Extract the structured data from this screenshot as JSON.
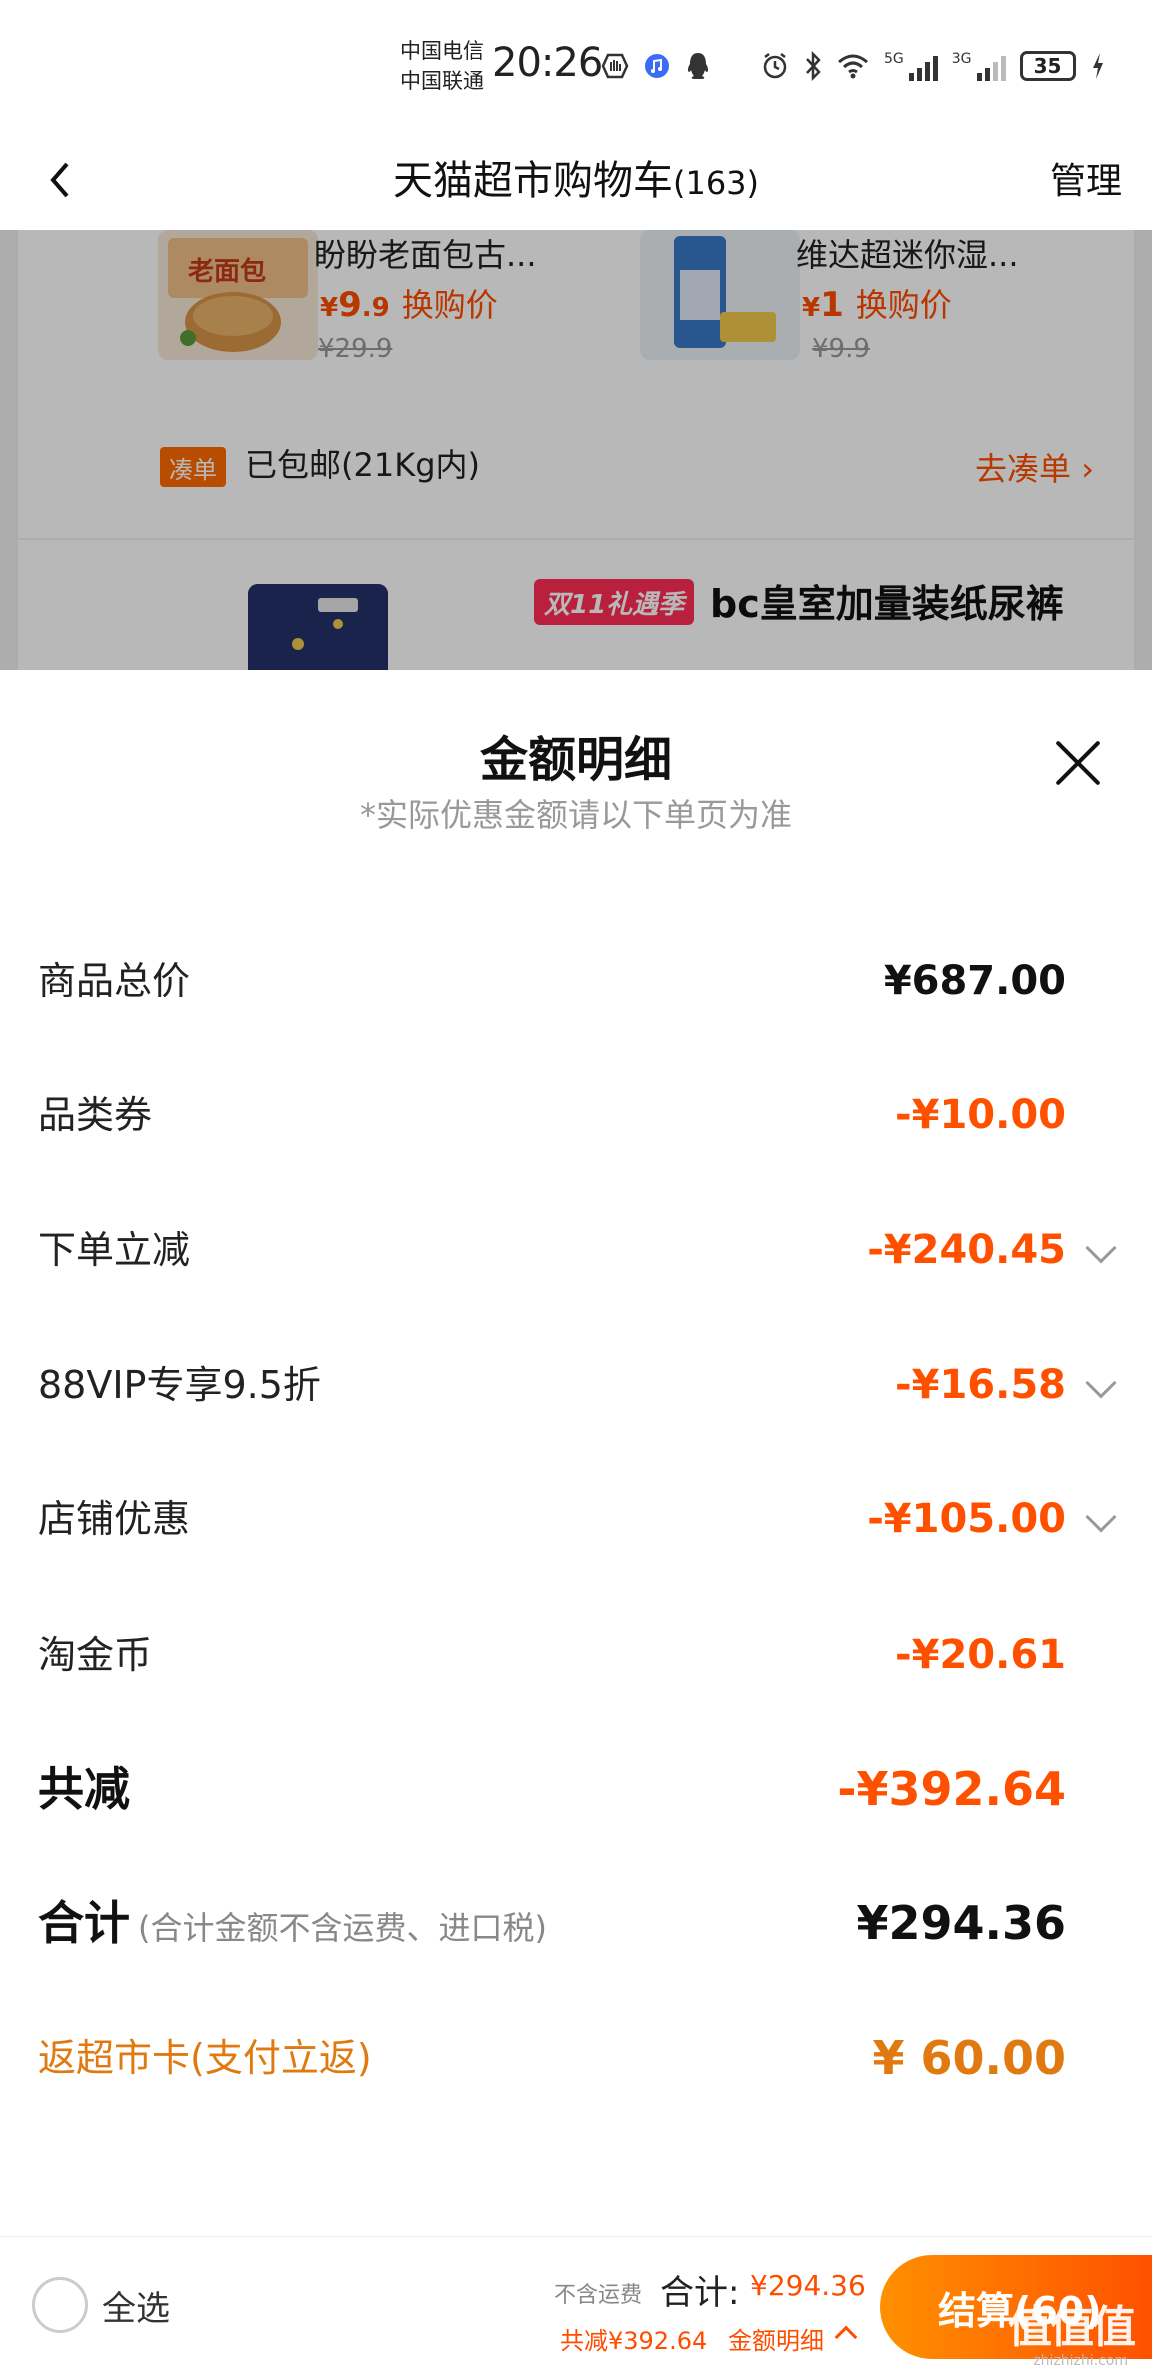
{
  "status_bar": {
    "carrier_1": "中国电信",
    "carrier_2": "中国联通",
    "time": "20:26",
    "signal_1_label": "5G",
    "signal_2_label": "3G",
    "battery": "35"
  },
  "nav": {
    "title": "天猫超市购物车",
    "count": "(163)",
    "manage_label": "管理"
  },
  "background": {
    "products": [
      {
        "name": "盼盼老面包古...",
        "price_int": "9",
        "price_dec": ".9",
        "price_tag": "换购价",
        "orig_price": "¥29.9"
      },
      {
        "name": "维达超迷你湿...",
        "price_int": "1",
        "price_dec": "",
        "price_tag": "换购价",
        "orig_price": "¥9.9"
      }
    ],
    "currency": "¥",
    "bundle_badge": "凑单",
    "shipping_text": "已包邮(21Kg内)",
    "bundle_link": "去凑单 ›",
    "promo_badge": "双11礼遇季",
    "promo_title": "bc皇室加量装纸尿裤"
  },
  "sheet": {
    "title": "金额明细",
    "subtitle": "*实际优惠金额请以下单页为准",
    "rows": [
      {
        "label": "商品总价",
        "value": "¥687.00"
      },
      {
        "label": "品类券",
        "value": "-¥10.00"
      },
      {
        "label": "下单立减",
        "value": "-¥240.45"
      },
      {
        "label": "88VIP专享9.5折",
        "value": "-¥16.58"
      },
      {
        "label": "店铺优惠",
        "value": "-¥105.00"
      },
      {
        "label": "淘金币",
        "value": "-¥20.61"
      }
    ],
    "total_saved": {
      "label": "共减",
      "value": "-¥392.64"
    },
    "total": {
      "label": "合计",
      "note": "(合计金额不含运费、进口税)",
      "value": "¥294.36"
    },
    "cashback": {
      "label": "返超市卡(支付立返)",
      "value": "¥ 60.00"
    }
  },
  "bottom_bar": {
    "select_all": "全选",
    "excl_shipping": "不含运费",
    "total_label": "合计:",
    "total_value": "¥294.36",
    "saved_text": "共减¥392.64",
    "details_link": "金额明细",
    "checkout_label": "结算(60)",
    "watermark": "值值值",
    "watermark_url": "zhizhizhi.com"
  },
  "colors": {
    "accent": "#ff5000",
    "cashback": "#e07a10",
    "checkout_gradient_start": "#ff9000",
    "checkout_gradient_end": "#ff5000"
  }
}
